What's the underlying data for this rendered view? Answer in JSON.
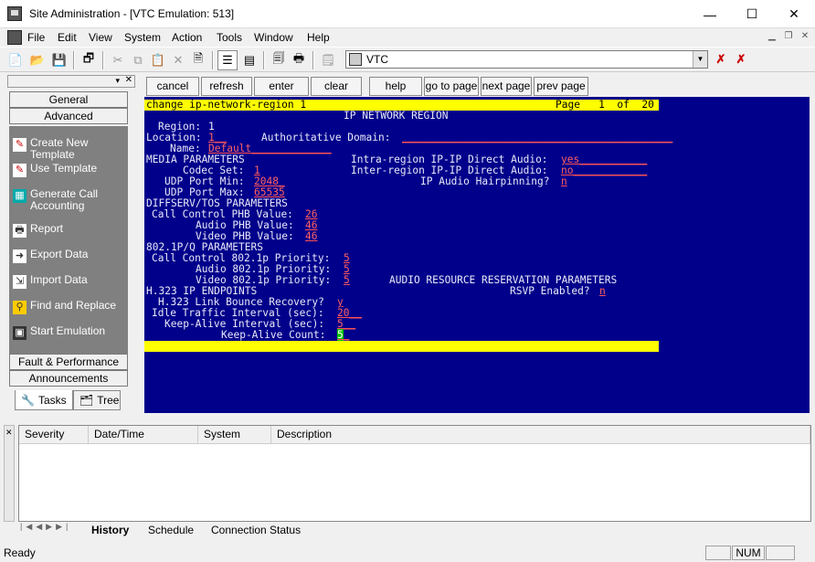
{
  "window": {
    "title": "Site Administration - [VTC Emulation: 513]",
    "minimize": "—",
    "maximize": "☐",
    "close": "✕"
  },
  "menu": [
    "File",
    "Edit",
    "View",
    "System",
    "Action",
    "Tools",
    "Window",
    "Help"
  ],
  "toolbar": {
    "combo_value": "VTC"
  },
  "left_pane": {
    "nav_top": [
      "General",
      "Advanced"
    ],
    "tasks": [
      {
        "label": "Create New Template",
        "icon": "create-template-icon"
      },
      {
        "label": "Use Template",
        "icon": "use-template-icon"
      },
      {
        "label": "Generate Call Accounting",
        "icon": "call-accounting-icon"
      },
      {
        "label": "Report",
        "icon": "report-icon"
      },
      {
        "label": "Export Data",
        "icon": "export-icon"
      },
      {
        "label": "Import Data",
        "icon": "import-icon"
      },
      {
        "label": "Find and Replace",
        "icon": "find-replace-icon"
      },
      {
        "label": "Start Emulation",
        "icon": "emulation-icon"
      }
    ],
    "nav_bottom": [
      "Fault & Performance",
      "Announcements"
    ],
    "tabs": [
      "Tasks",
      "Tree"
    ]
  },
  "command_buttons": [
    "cancel",
    "refresh",
    "enter",
    "clear",
    "help",
    "go to page",
    "next page",
    "prev page"
  ],
  "terminal": {
    "command": "change ip-network-region 1",
    "page_label": "Page",
    "page_num": "1",
    "page_of": "of",
    "page_total": "20",
    "form_title": "IP NETWORK REGION",
    "region_label": "Region:",
    "region_value": "1",
    "location_label": "Location:",
    "location_value": "1",
    "auth_domain_label": "Authoritative Domain:",
    "name_label": "Name:",
    "name_value": "Default",
    "media_params": "MEDIA PARAMETERS",
    "intra_label": "Intra-region IP-IP Direct Audio:",
    "intra_value": "yes",
    "codec_label": "Codec Set:",
    "codec_value": "1",
    "inter_label": "Inter-region IP-IP Direct Audio:",
    "inter_value": "no",
    "udp_min_label": "UDP Port Min:",
    "udp_min_value": "2048",
    "hairpin_label": "IP Audio Hairpinning?",
    "hairpin_value": "n",
    "udp_max_label": "UDP Port Max:",
    "udp_max_value": "65535",
    "diffserv": "DIFFSERV/TOS PARAMETERS",
    "cc_phb_label": "Call Control PHB Value:",
    "cc_phb_value": "26",
    "audio_phb_label": "Audio PHB Value:",
    "audio_phb_value": "46",
    "video_phb_label": "Video PHB Value:",
    "video_phb_value": "46",
    "p8021": "802.1P/Q PARAMETERS",
    "cc_8021_label": "Call Control 802.1p Priority:",
    "cc_8021_value": "5",
    "audio_8021_label": "Audio 802.1p Priority:",
    "audio_8021_value": "5",
    "video_8021_label": "Video 802.1p Priority:",
    "video_8021_value": "5",
    "arr_params": "AUDIO RESOURCE RESERVATION PARAMETERS",
    "h323": "H.323 IP ENDPOINTS",
    "rsvp_label": "RSVP Enabled?",
    "rsvp_value": "n",
    "bounce_label": "H.323 Link Bounce Recovery?",
    "bounce_value": "y",
    "idle_label": "Idle Traffic Interval (sec):",
    "idle_value": "20",
    "keepalive_label": "Keep-Alive Interval (sec):",
    "keepalive_value": "5",
    "kacount_label": "Keep-Alive Count:",
    "kacount_value": "5"
  },
  "alarms": {
    "columns": [
      "Severity",
      "Date/Time",
      "System",
      "Description"
    ],
    "tabs": [
      "History",
      "Schedule",
      "Connection Status"
    ]
  },
  "status": {
    "text": "Ready",
    "num": "NUM"
  }
}
